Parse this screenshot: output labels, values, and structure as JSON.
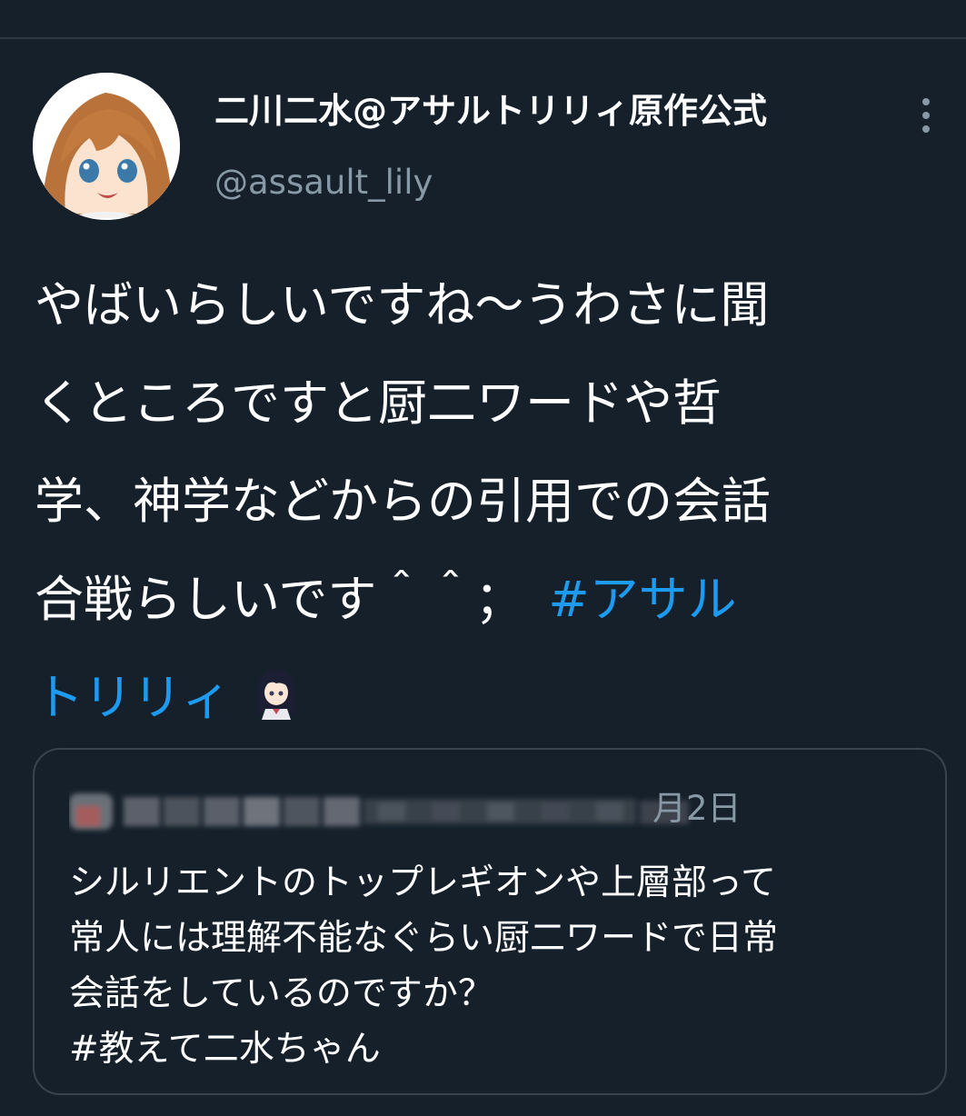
{
  "tweet": {
    "author": {
      "display_name": "二川二水@アサルトリリィ原作公式",
      "handle": "@assault_lily"
    },
    "text_lines": [
      "やばいらしいですね〜うわさに聞",
      "くところですと厨二ワードや哲",
      "学、神学などからの引用での会話",
      "合戦らしいです＾＾；　"
    ],
    "hashtag": {
      "part1": "#アサル",
      "part2": "トリリィ"
    },
    "emoji_icon": "assault-lily-character-emoji"
  },
  "quoted_tweet": {
    "author_blurred": true,
    "date": "月2日",
    "text_lines": [
      "シルリエントのトップレギオンや上層部って",
      "常人には理解不能なぐらい厨二ワードで日常",
      "会話をしているのですか？",
      "#教えて二水ちゃん"
    ]
  },
  "colors": {
    "background": "#15202b",
    "text": "#ffffff",
    "secondary_text": "#8899a6",
    "hashtag": "#1d9bf0",
    "border": "#38444d"
  }
}
